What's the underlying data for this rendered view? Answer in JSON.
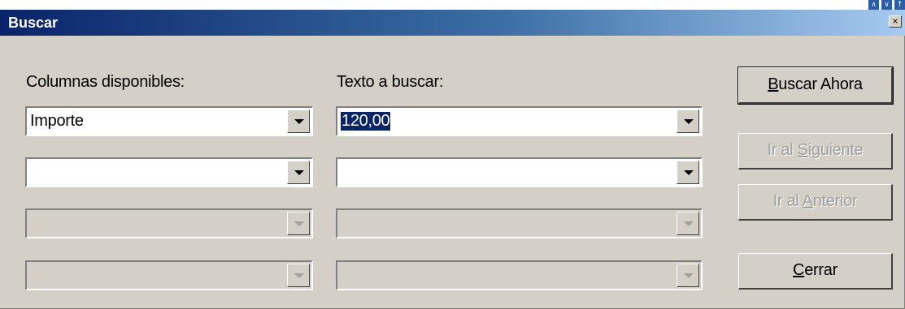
{
  "dialog": {
    "title": "Buscar",
    "close_glyph": "×"
  },
  "corner_icons": [
    "∧",
    "∨",
    "↑"
  ],
  "labels": {
    "columns": "Columnas disponibles:",
    "search_text": "Texto a buscar:"
  },
  "rows": [
    {
      "column": "Importe",
      "text": "120,00",
      "enabled": true
    },
    {
      "column": "",
      "text": "",
      "enabled": true
    },
    {
      "column": "",
      "text": "",
      "enabled": false
    },
    {
      "column": "",
      "text": "",
      "enabled": false
    }
  ],
  "buttons": {
    "search_now": {
      "prefix": "",
      "accel": "B",
      "suffix": "uscar Ahora",
      "enabled": true
    },
    "next": {
      "prefix": "Ir al ",
      "accel": "S",
      "suffix": "iguiente",
      "enabled": false
    },
    "previous": {
      "prefix": "Ir al ",
      "accel": "A",
      "suffix": "nterior",
      "enabled": false
    },
    "close": {
      "prefix": "",
      "accel": "C",
      "suffix": "errar",
      "enabled": true
    }
  },
  "colors": {
    "titlebar_start": "#0a246a",
    "titlebar_end": "#a6caf0",
    "face": "#d4d0c8",
    "selection": "#0a246a"
  }
}
